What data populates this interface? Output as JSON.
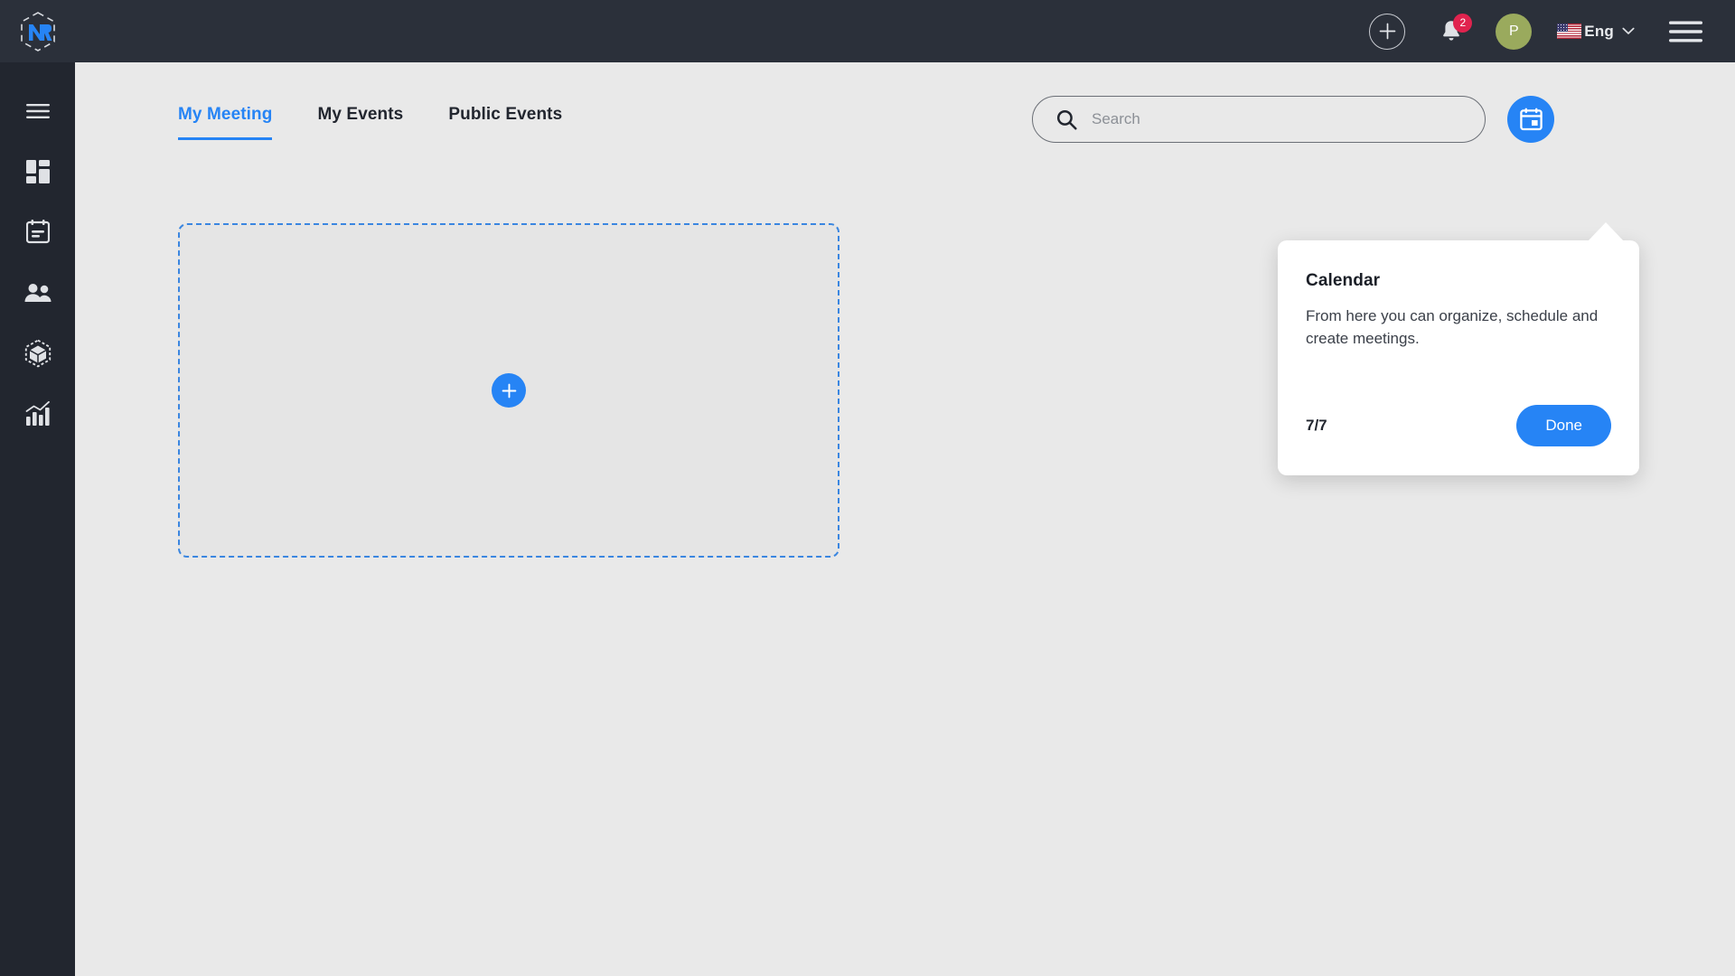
{
  "app": {
    "brand_name": "nr-logo",
    "bg_color": "#e9e9e9",
    "header_color": "#2b303a",
    "sidebar_color": "#22262f",
    "accent_color": "#2684f5",
    "badge_color": "#e0234e",
    "avatar_color": "#9aaa5d"
  },
  "header": {
    "add_button_label": "add-icon",
    "notifications": {
      "icon": "bell-icon",
      "count": "2"
    },
    "avatar": {
      "initial": "P",
      "icon": "avatar"
    },
    "language": {
      "label": "Eng",
      "flag": "us-flag-icon",
      "chevron": "chevron-down-icon"
    },
    "menu_icon": "hamburger-menu-icon"
  },
  "sidebar": {
    "items": [
      {
        "name": "menu-toggle",
        "icon": "hamburger-menu-icon"
      },
      {
        "name": "dashboard",
        "icon": "dashboard-grid-icon"
      },
      {
        "name": "calendar",
        "icon": "calendar-icon"
      },
      {
        "name": "contacts",
        "icon": "people-icon"
      },
      {
        "name": "products",
        "icon": "cube-box-icon"
      },
      {
        "name": "analytics",
        "icon": "bar-chart-icon"
      }
    ]
  },
  "main": {
    "tabs": [
      {
        "label": "My Meeting",
        "active": true
      },
      {
        "label": "My Events",
        "active": false
      },
      {
        "label": "Public Events",
        "active": false
      }
    ],
    "search": {
      "placeholder": "Search",
      "value": "",
      "icon": "search-icon"
    },
    "calendar_button": {
      "icon": "calendar-today-icon"
    },
    "empty_card": {
      "add_button_label": "+",
      "add_button_icon": "plus-icon"
    }
  },
  "coachmark": {
    "title": "Calendar",
    "body": "From here you can organize, schedule and create meetings.",
    "step": "7/7",
    "done_label": "Done"
  }
}
